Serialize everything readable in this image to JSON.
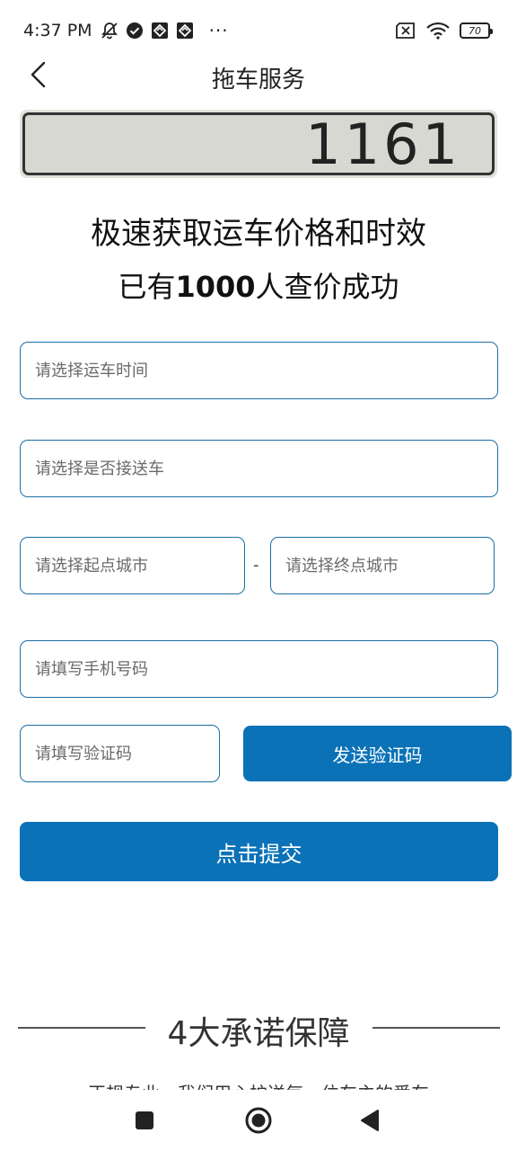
{
  "status_bar": {
    "time": "4:37 PM",
    "more": "···",
    "battery": "70",
    "icons_left": [
      "mute-icon",
      "check-circle-icon",
      "app-notification-icon",
      "app-notification-icon"
    ],
    "icons_right": [
      "sim-x-icon",
      "wifi-icon",
      "battery-icon"
    ]
  },
  "nav": {
    "title": "拖车服务"
  },
  "banner": {
    "number": "1161"
  },
  "headline": {
    "line1": "极速获取运车价格和时效",
    "line2_prefix": "已有",
    "line2_count": "1000",
    "line2_suffix": "人查价成功"
  },
  "form": {
    "time_placeholder": "请选择运车时间",
    "pickup_placeholder": "请选择是否接送车",
    "start_city_placeholder": "请选择起点城市",
    "separator": "-",
    "end_city_placeholder": "请选择终点城市",
    "phone_placeholder": "请填写手机号码",
    "code_placeholder": "请填写验证码",
    "send_code_label": "发送验证码",
    "submit_label": "点击提交"
  },
  "promise": {
    "title": "4大承诺保障",
    "subline": "正规专业，我们用心护送每一位车主的爱车"
  },
  "colors": {
    "primary": "#0b72b8",
    "field_border": "#1a6ea3",
    "banner_bg": "#d8d8d2"
  }
}
